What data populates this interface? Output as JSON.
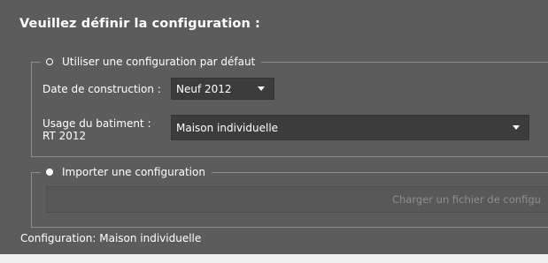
{
  "heading": "Veuillez définir la configuration :",
  "default_group": {
    "radio_label": "Utiliser une configuration par défaut",
    "selected": false,
    "date_label": "Date de construction :",
    "date_value": "Neuf 2012",
    "usage_label_line1": "Usage du batiment :",
    "usage_label_line2": "RT 2012",
    "usage_value": "Maison individuelle"
  },
  "import_group": {
    "radio_label": "Importer une configuration",
    "selected": true,
    "load_button_label": "Charger un fichier de configu"
  },
  "status": "Configuration: Maison individuelle",
  "colors": {
    "window_background": "#5c5c5c",
    "combo_background": "#3c3c3c",
    "disabled_text": "#8f8f8f"
  },
  "icons": {
    "dropdown": "chevron-down-icon",
    "radio_unchecked": "radio-unchecked-icon",
    "radio_checked": "radio-checked-icon"
  }
}
